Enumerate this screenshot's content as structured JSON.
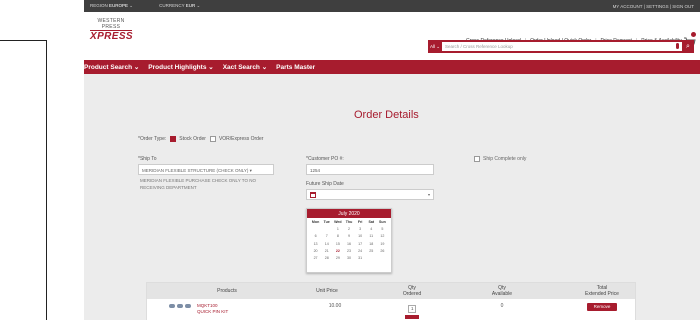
{
  "topbar": {
    "region_label": "REGION",
    "region_value": "EUROPE",
    "currency_label": "CURRENCY",
    "currency_value": "EUR",
    "account_link": "MY ACCOUNT | SETTINGS | SIGN OUT"
  },
  "header": {
    "logo_top": "WESTERN PRESS",
    "logo_main": "XPRESS",
    "links": [
      "Cross Reference Upload",
      "Order Upload / Quick Order",
      "Price Request",
      "Price & Availability"
    ],
    "search_scope": "All",
    "search_placeholder": "Search / Cross Reference Lookup"
  },
  "nav": {
    "items": [
      "Product Search ⌄",
      "Product Highlights ⌄",
      "Xact Search ⌄",
      "Parts Master"
    ]
  },
  "page": {
    "title": "Order Details"
  },
  "order_type": {
    "label": "*Order Type:",
    "option1": "Stock Order",
    "option2": "VOR/Express Order"
  },
  "ship_to": {
    "label": "*Ship To",
    "value": "MERIDIAN FLEXIBLE STRUCTURE (CHECK ONLY) ▾",
    "address": "MERIDIAN FLEXIBLE PURCHASE CHECK ONLY TO NO RECEIVING DEPARTMENT"
  },
  "customer_po": {
    "label": "*Customer PO #:",
    "value": "1254"
  },
  "future_ship": {
    "label": "Future Ship Date"
  },
  "ship_complete": {
    "label": "Ship Complete only"
  },
  "calendar": {
    "month": "July 2020",
    "dow": [
      "Mon",
      "Tue",
      "Wed",
      "Thu",
      "Fri",
      "Sat",
      "Sun"
    ],
    "days": [
      "",
      "",
      "1",
      "2",
      "3",
      "4",
      "5",
      "6",
      "7",
      "8",
      "9",
      "10",
      "11",
      "12",
      "13",
      "14",
      "15",
      "16",
      "17",
      "18",
      "19",
      "20",
      "21",
      "22",
      "23",
      "24",
      "25",
      "26",
      "27",
      "28",
      "29",
      "30",
      "31",
      "",
      ""
    ],
    "highlight": "22"
  },
  "table": {
    "headers": [
      "Products",
      "Unit Price",
      "Qty\nOrdered",
      "Qty\nAvailable",
      "Total\nExtended Price"
    ],
    "row": {
      "product_line1": "MQKT100",
      "product_line2": "QUICK PIN KIT",
      "unit_price": "10.00",
      "qty_ordered": "1",
      "qty_available": "0",
      "extended_price": "10.00",
      "remove_label": "Remove"
    }
  },
  "colors": {
    "brand": "#a71c2e",
    "topbar": "#3f3f3f"
  }
}
